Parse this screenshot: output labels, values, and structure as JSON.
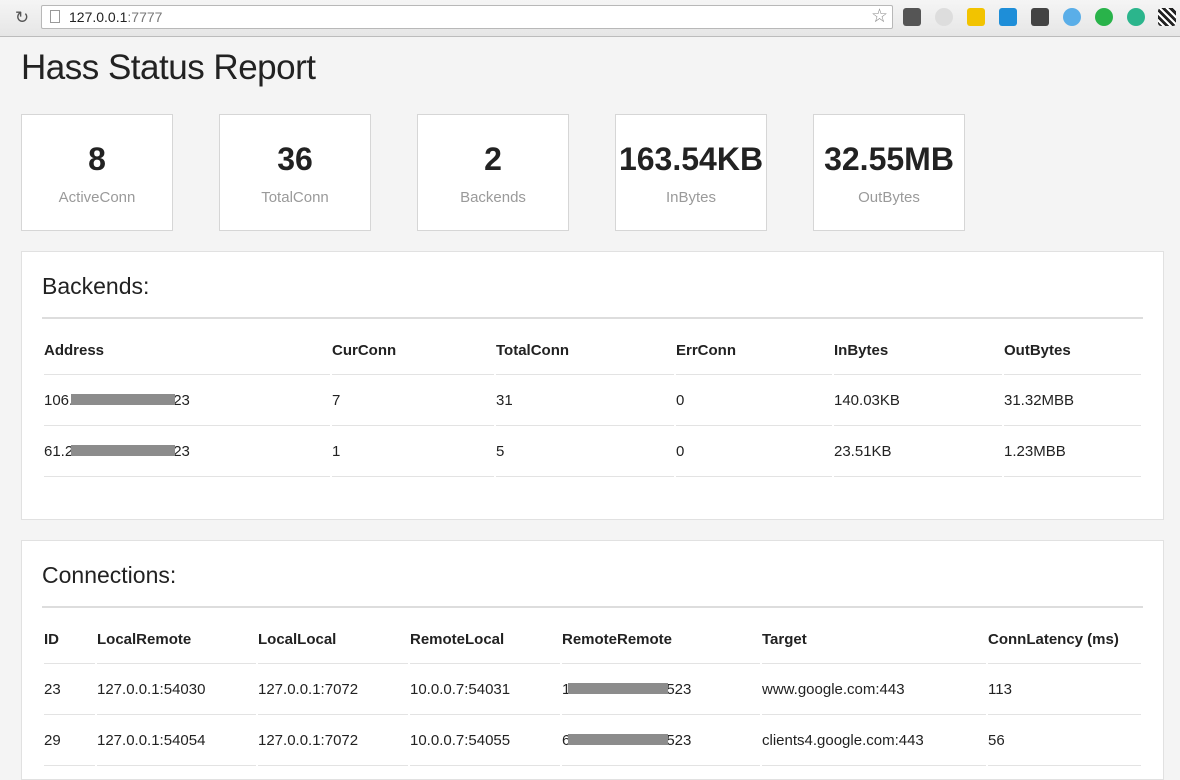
{
  "browser": {
    "url_host": "127.0.0.1",
    "url_port": ":7777"
  },
  "page": {
    "title": "Hass Status Report"
  },
  "stats": [
    {
      "value": "8",
      "label": "ActiveConn"
    },
    {
      "value": "36",
      "label": "TotalConn"
    },
    {
      "value": "2",
      "label": "Backends"
    },
    {
      "value": "163.54KB",
      "label": "InBytes"
    },
    {
      "value": "32.55MB",
      "label": "OutBytes"
    }
  ],
  "backends": {
    "title": "Backends:",
    "headers": [
      "Address",
      "CurConn",
      "TotalConn",
      "ErrConn",
      "InBytes",
      "OutBytes"
    ],
    "rows": [
      {
        "addr_start": "106.",
        "addr_end": "23",
        "cur": "7",
        "total": "31",
        "err": "0",
        "in": "140.03KB",
        "out": "31.32MBB"
      },
      {
        "addr_start": "61.2",
        "addr_end": "23",
        "cur": "1",
        "total": "5",
        "err": "0",
        "in": "23.51KB",
        "out": "1.23MBB"
      }
    ]
  },
  "connections": {
    "title": "Connections:",
    "headers": [
      "ID",
      "LocalRemote",
      "LocalLocal",
      "RemoteLocal",
      "RemoteRemote",
      "Target",
      "ConnLatency (ms)"
    ],
    "rows": [
      {
        "id": "23",
        "local_remote": "127.0.0.1:54030",
        "local_local": "127.0.0.1:7072",
        "remote_local": "10.0.0.7:54031",
        "rr_start": "1",
        "rr_end": "523",
        "target": "www.google.com:443",
        "latency": "113"
      },
      {
        "id": "29",
        "local_remote": "127.0.0.1:54054",
        "local_local": "127.0.0.1:7072",
        "remote_local": "10.0.0.7:54055",
        "rr_start": "6",
        "rr_end": "523",
        "target": "clients4.google.com:443",
        "latency": "56"
      }
    ]
  },
  "extensions": [
    "evernote-icon",
    "sync-icon",
    "notes-icon",
    "xmarks-icon",
    "dictionary-icon",
    "vimium-icon",
    "green-leaf-icon",
    "globe-icon",
    "qr-code-icon"
  ]
}
